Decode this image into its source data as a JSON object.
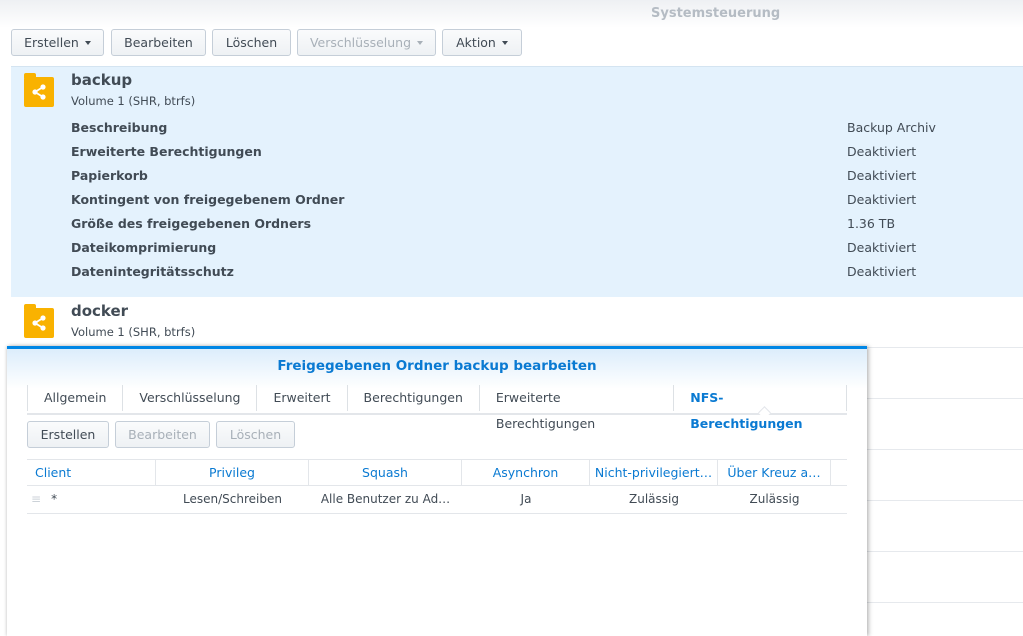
{
  "window": {
    "title": "Systemsteuerung"
  },
  "toolbar": {
    "create": "Erstellen",
    "edit": "Bearbeiten",
    "delete": "Löschen",
    "encryption": "Verschlüsselung",
    "action": "Aktion"
  },
  "folders": [
    {
      "name": "backup",
      "volume": "Volume 1 (SHR, btrfs)",
      "properties": [
        {
          "key": "Beschreibung",
          "value": "Backup Archiv"
        },
        {
          "key": "Erweiterte Berechtigungen",
          "value": "Deaktiviert"
        },
        {
          "key": "Papierkorb",
          "value": "Deaktiviert"
        },
        {
          "key": "Kontingent von freigegebenem Ordner",
          "value": "Deaktiviert"
        },
        {
          "key": "Größe des freigegebenen Ordners",
          "value": "1.36 TB"
        },
        {
          "key": "Dateikomprimierung",
          "value": "Deaktiviert"
        },
        {
          "key": "Datenintegritätsschutz",
          "value": "Deaktiviert"
        }
      ]
    },
    {
      "name": "docker",
      "volume": "Volume 1 (SHR, btrfs)"
    }
  ],
  "dialog": {
    "title": "Freigegebenen Ordner backup bearbeiten",
    "tabs": [
      "Allgemein",
      "Verschlüsselung",
      "Erweitert",
      "Berechtigungen",
      "Erweiterte Berechtigungen",
      "NFS-Berechtigungen"
    ],
    "active_tab": "NFS-Berechtigungen",
    "buttons": {
      "create": "Erstellen",
      "edit": "Bearbeiten",
      "delete": "Löschen"
    },
    "columns": [
      "Client",
      "Privileg",
      "Squash",
      "Asynchron",
      "Nicht-privilegiert…",
      "Über Kreuz a…"
    ],
    "rows": [
      [
        "*",
        "Lesen/Schreiben",
        "Alle Benutzer zu Ad…",
        "Ja",
        "Zulässig",
        "Zulässig"
      ]
    ]
  },
  "colors": {
    "accent": "#0086e5",
    "folder": "#f9b200",
    "selected": "#e4f2fd"
  }
}
